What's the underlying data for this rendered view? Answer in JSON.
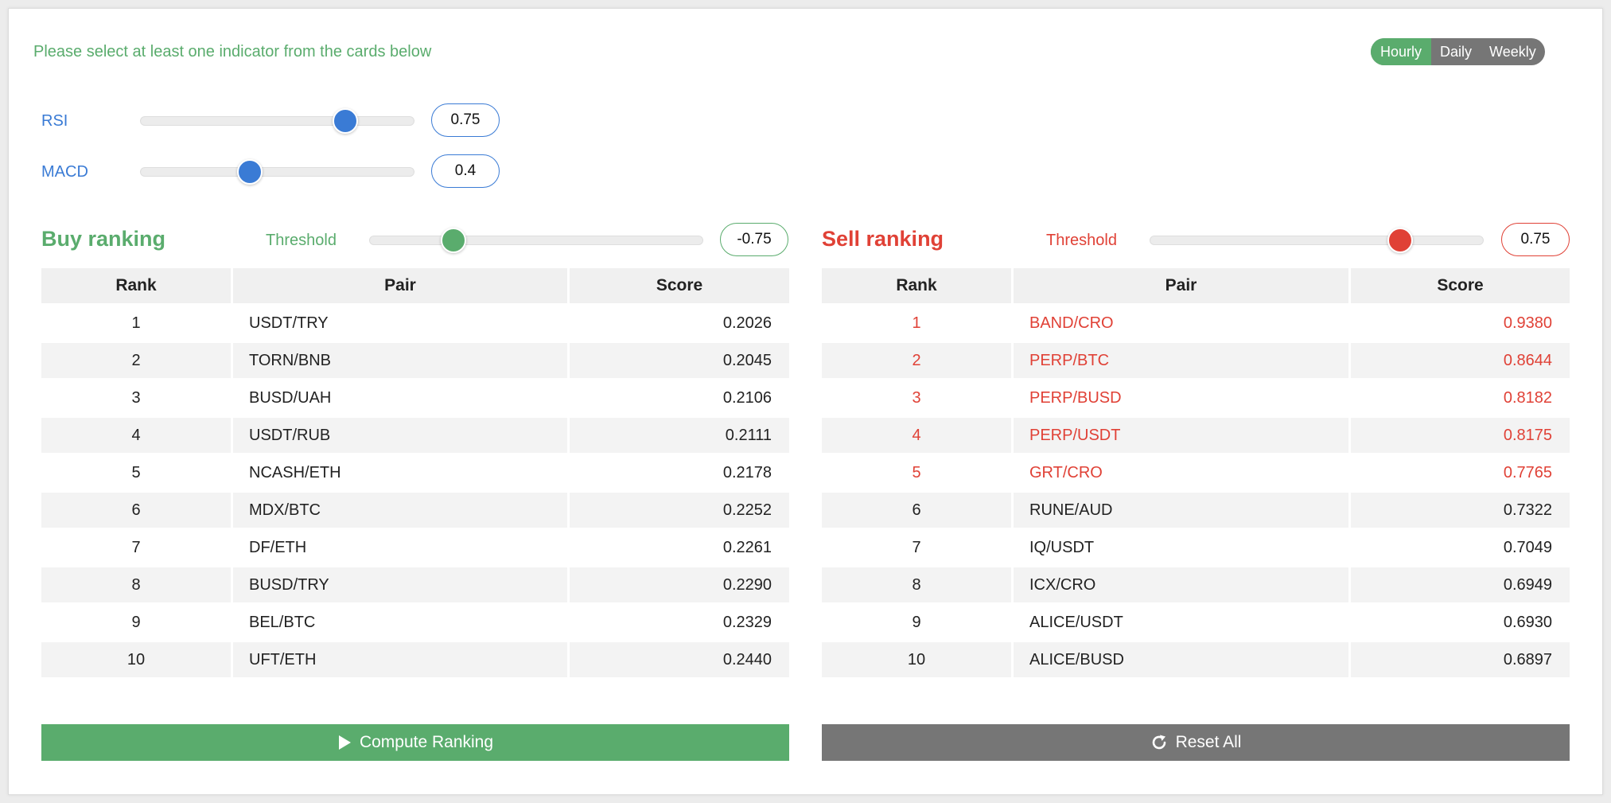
{
  "notice": "Please select at least one indicator from the cards below",
  "period": {
    "options": [
      "Hourly",
      "Daily",
      "Weekly"
    ],
    "selected": "Hourly"
  },
  "indicators": [
    {
      "name": "RSI",
      "value": "0.75",
      "level": 0.75
    },
    {
      "name": "MACD",
      "value": "0.4",
      "level": 0.4
    }
  ],
  "buy": {
    "title": "Buy ranking",
    "threshold_label": "Threshold",
    "threshold": "-0.75",
    "threshold_level": 0.25,
    "columns": [
      "Rank",
      "Pair",
      "Score"
    ],
    "rows": [
      {
        "rank": "1",
        "pair": "USDT/TRY",
        "score": "0.2026"
      },
      {
        "rank": "2",
        "pair": "TORN/BNB",
        "score": "0.2045"
      },
      {
        "rank": "3",
        "pair": "BUSD/UAH",
        "score": "0.2106"
      },
      {
        "rank": "4",
        "pair": "USDT/RUB",
        "score": "0.2111"
      },
      {
        "rank": "5",
        "pair": "NCASH/ETH",
        "score": "0.2178"
      },
      {
        "rank": "6",
        "pair": "MDX/BTC",
        "score": "0.2252"
      },
      {
        "rank": "7",
        "pair": "DF/ETH",
        "score": "0.2261"
      },
      {
        "rank": "8",
        "pair": "BUSD/TRY",
        "score": "0.2290"
      },
      {
        "rank": "9",
        "pair": "BEL/BTC",
        "score": "0.2329"
      },
      {
        "rank": "10",
        "pair": "UFT/ETH",
        "score": "0.2440"
      }
    ]
  },
  "sell": {
    "title": "Sell ranking",
    "threshold_label": "Threshold",
    "threshold": "0.75",
    "threshold_level": 0.75,
    "columns": [
      "Rank",
      "Pair",
      "Score"
    ],
    "rows": [
      {
        "rank": "1",
        "pair": "BAND/CRO",
        "score": "0.9380",
        "highlight": true
      },
      {
        "rank": "2",
        "pair": "PERP/BTC",
        "score": "0.8644",
        "highlight": true
      },
      {
        "rank": "3",
        "pair": "PERP/BUSD",
        "score": "0.8182",
        "highlight": true
      },
      {
        "rank": "4",
        "pair": "PERP/USDT",
        "score": "0.8175",
        "highlight": true
      },
      {
        "rank": "5",
        "pair": "GRT/CRO",
        "score": "0.7765",
        "highlight": true
      },
      {
        "rank": "6",
        "pair": "RUNE/AUD",
        "score": "0.7322",
        "highlight": false
      },
      {
        "rank": "7",
        "pair": "IQ/USDT",
        "score": "0.7049",
        "highlight": false
      },
      {
        "rank": "8",
        "pair": "ICX/CRO",
        "score": "0.6949",
        "highlight": false
      },
      {
        "rank": "9",
        "pair": "ALICE/USDT",
        "score": "0.6930",
        "highlight": false
      },
      {
        "rank": "10",
        "pair": "ALICE/BUSD",
        "score": "0.6897",
        "highlight": false
      }
    ]
  },
  "buttons": {
    "compute": "Compute Ranking",
    "compute_icon": "play-icon",
    "reset": "Reset All",
    "reset_icon": "refresh-icon"
  },
  "colors": {
    "buy": "#5aac6d",
    "sell": "#e04136",
    "indicator": "#3a7bd5",
    "neutral": "#767676"
  }
}
